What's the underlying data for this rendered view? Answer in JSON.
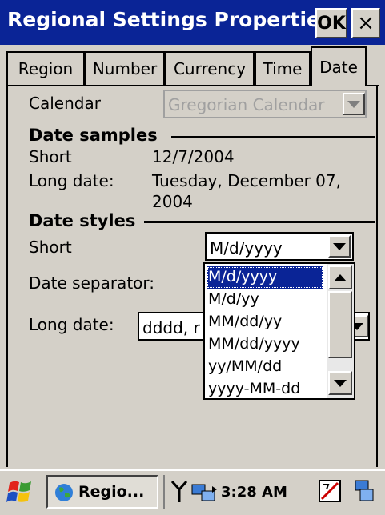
{
  "window": {
    "title": "Regional Settings Properties",
    "ok_label": "OK",
    "close_label": "×"
  },
  "tabs": [
    {
      "label": "Region"
    },
    {
      "label": "Number"
    },
    {
      "label": "Currency"
    },
    {
      "label": "Time"
    },
    {
      "label": "Date",
      "active": true
    }
  ],
  "calendar": {
    "label": "Calendar",
    "value": "Gregorian Calendar",
    "disabled": true
  },
  "samples": {
    "header": "Date samples",
    "short_label": "Short",
    "short_value": "12/7/2004",
    "long_label": "Long date:",
    "long_value_line1": "Tuesday, December 07,",
    "long_value_line2": "2004"
  },
  "styles": {
    "header": "Date styles",
    "short_label": "Short",
    "short_value": "M/d/yyyy",
    "separator_label": "Date separator:",
    "long_label": "Long date:",
    "long_value": "dddd, MMMM dd, yyyy",
    "long_value_visible": "dddd, r"
  },
  "dropdown": {
    "options": [
      "M/d/yyyy",
      "M/d/yy",
      "MM/dd/yy",
      "MM/dd/yyyy",
      "yy/MM/dd",
      "yyyy-MM-dd"
    ],
    "selected": "M/d/yyyy"
  },
  "taskbar": {
    "task_label": "Regio...",
    "clock": "3:28 AM"
  },
  "colors": {
    "title_bar": "#0a2496",
    "face": "#d4d0c8",
    "selection": "#0a2496"
  }
}
